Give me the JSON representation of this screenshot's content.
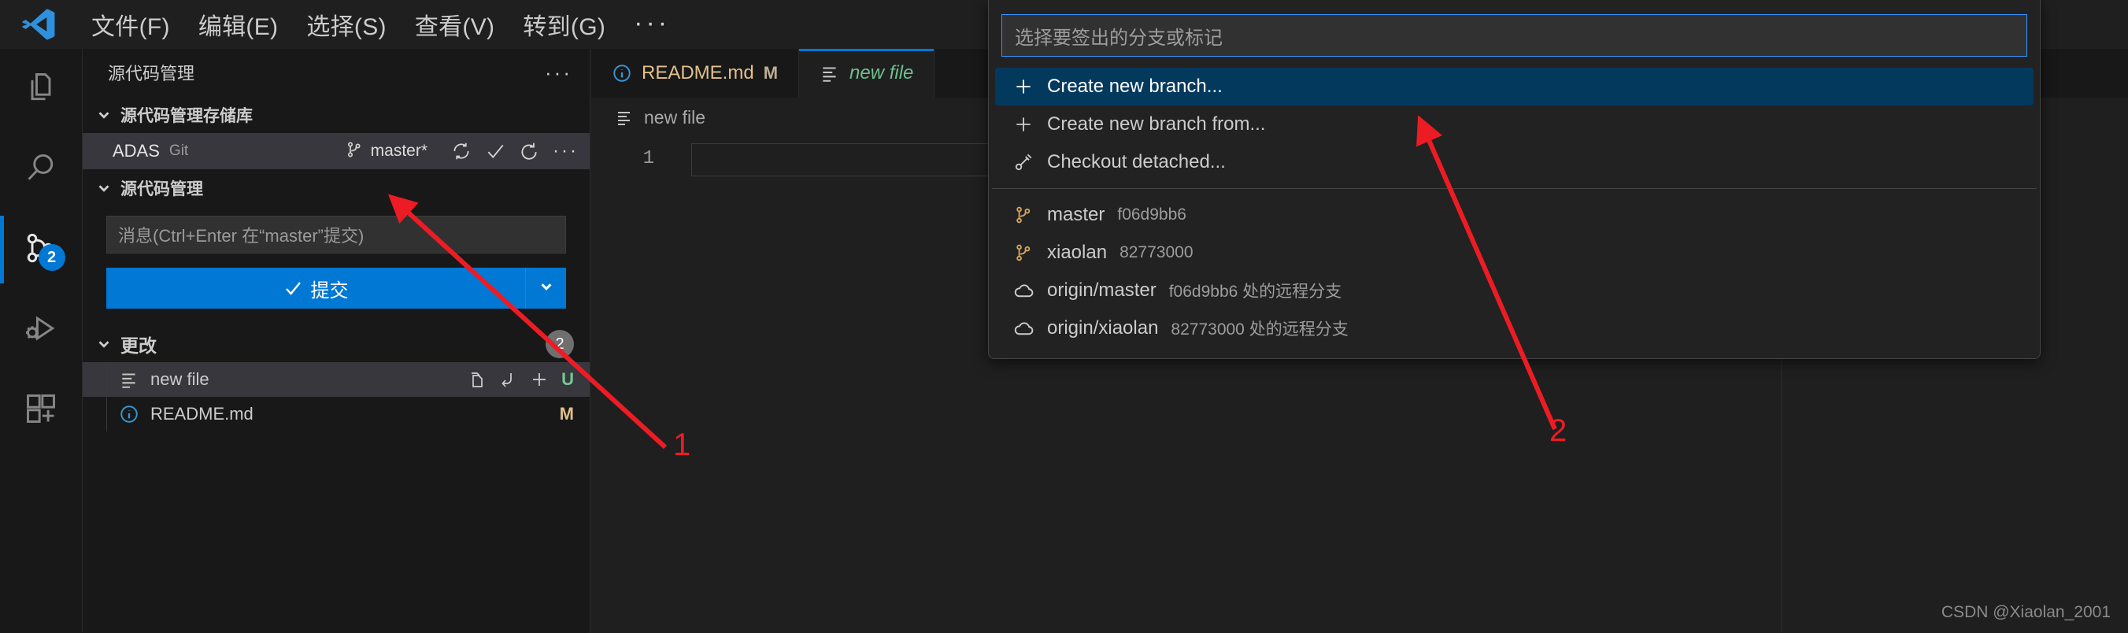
{
  "titlebar": {
    "logo_icon": "vscode-logo-icon",
    "menus": [
      {
        "label": "文件(F)",
        "accel": "F"
      },
      {
        "label": "编辑(E)",
        "accel": "E"
      },
      {
        "label": "选择(S)",
        "accel": "S"
      },
      {
        "label": "查看(V)",
        "accel": "V"
      },
      {
        "label": "转到(G)",
        "accel": "G"
      }
    ],
    "more_label": "···"
  },
  "activitybar": {
    "items": [
      {
        "name": "explorer",
        "icon": "files-icon",
        "active": false,
        "badge": null
      },
      {
        "name": "search",
        "icon": "search-icon",
        "active": false,
        "badge": null
      },
      {
        "name": "source-control",
        "icon": "source-control-icon",
        "active": true,
        "badge": "2"
      },
      {
        "name": "run-debug",
        "icon": "run-and-debug-icon",
        "active": false,
        "badge": null
      },
      {
        "name": "extensions",
        "icon": "extensions-icon",
        "active": false,
        "badge": null
      }
    ],
    "badge_color": "#0078d4"
  },
  "sidebar": {
    "title": "源代码管理",
    "title_more": "···",
    "repos_section": {
      "label": "源代码管理存储库",
      "repo": {
        "name": "ADAS",
        "type": "Git",
        "branch": "master*",
        "actions": [
          "sync-icon",
          "commit-check-icon",
          "refresh-icon",
          "more-icon"
        ]
      }
    },
    "scm_section": {
      "label": "源代码管理",
      "commit_input_placeholder": "消息(Ctrl+Enter 在“master”提交)",
      "commit_button_label": "提交",
      "commit_dropdown_icon": "chevron-down-icon"
    },
    "changes_section": {
      "label": "更改",
      "count": "2",
      "files": [
        {
          "name": "new file",
          "icon": "plain-file-icon",
          "status": "U",
          "selected": true,
          "actions": [
            "open-changes-icon",
            "discard-changes-icon",
            "stage-changes-icon"
          ]
        },
        {
          "name": "README.md",
          "icon": "info-file-icon",
          "status": "M",
          "selected": false,
          "actions": []
        }
      ]
    }
  },
  "editor": {
    "tabs": [
      {
        "label": "README.md",
        "icon": "info-file-icon",
        "status": "M",
        "active": false
      },
      {
        "label": "new file",
        "icon": "plain-file-icon",
        "status": "",
        "active": true
      }
    ],
    "breadcrumb": {
      "label": "new file",
      "icon": "plain-file-icon"
    },
    "line_number": "1"
  },
  "quickpick": {
    "input_placeholder": "选择要签出的分支或标记",
    "items": [
      {
        "label": "Create new branch...",
        "desc": "",
        "icon": "plus-icon",
        "selected": true
      },
      {
        "label": "Create new branch from...",
        "desc": "",
        "icon": "plus-icon",
        "selected": false
      },
      {
        "label": "Checkout detached...",
        "desc": "",
        "icon": "detached-icon",
        "selected": false
      },
      {
        "separator": true
      },
      {
        "label": "master",
        "desc": "f06d9bb6",
        "icon": "branch-icon",
        "selected": false
      },
      {
        "label": "xiaolan",
        "desc": "82773000",
        "icon": "branch-icon",
        "selected": false
      },
      {
        "label": "origin/master",
        "desc": "f06d9bb6 处的远程分支",
        "icon": "cloud-icon",
        "selected": false
      },
      {
        "label": "origin/xiaolan",
        "desc": "82773000 处的远程分支",
        "icon": "cloud-icon",
        "selected": false
      }
    ],
    "selected_color": "#04395e",
    "border_color": "#3794ff"
  },
  "annotations": {
    "color": "#ed1c24",
    "markers": [
      {
        "label": "1"
      },
      {
        "label": "2"
      }
    ]
  },
  "watermark": "CSDN @Xiaolan_2001"
}
